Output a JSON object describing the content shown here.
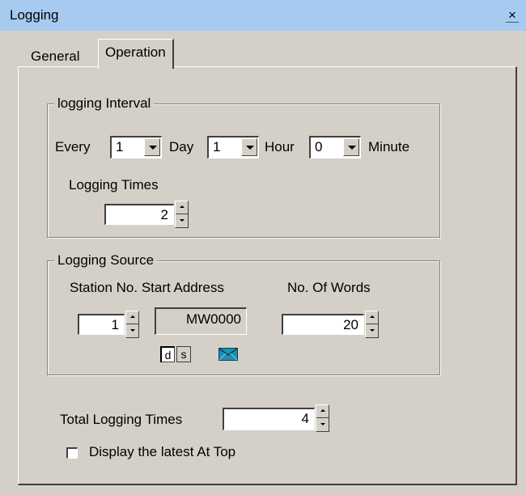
{
  "window": {
    "title": "Logging",
    "close_label": "×"
  },
  "tabs": [
    {
      "label": "General"
    },
    {
      "label": "Operation"
    }
  ],
  "interval": {
    "legend": "logging Interval",
    "every_label": "Every",
    "day_value": "1",
    "day_label": "Day",
    "hour_value": "1",
    "hour_label": "Hour",
    "minute_value": "0",
    "minute_label": "Minute",
    "times_label": "Logging Times",
    "times_value": "2"
  },
  "source": {
    "legend": "Logging Source",
    "station_header": "Station No. Start Address",
    "words_header": "No. Of Words",
    "station_value": "1",
    "address_value": "MW0000",
    "words_value": "20",
    "mode_d": "d",
    "mode_s": "s"
  },
  "total": {
    "label": "Total Logging Times",
    "value": "4"
  },
  "display_latest": {
    "label": "Display the latest At Top",
    "checked": false
  }
}
